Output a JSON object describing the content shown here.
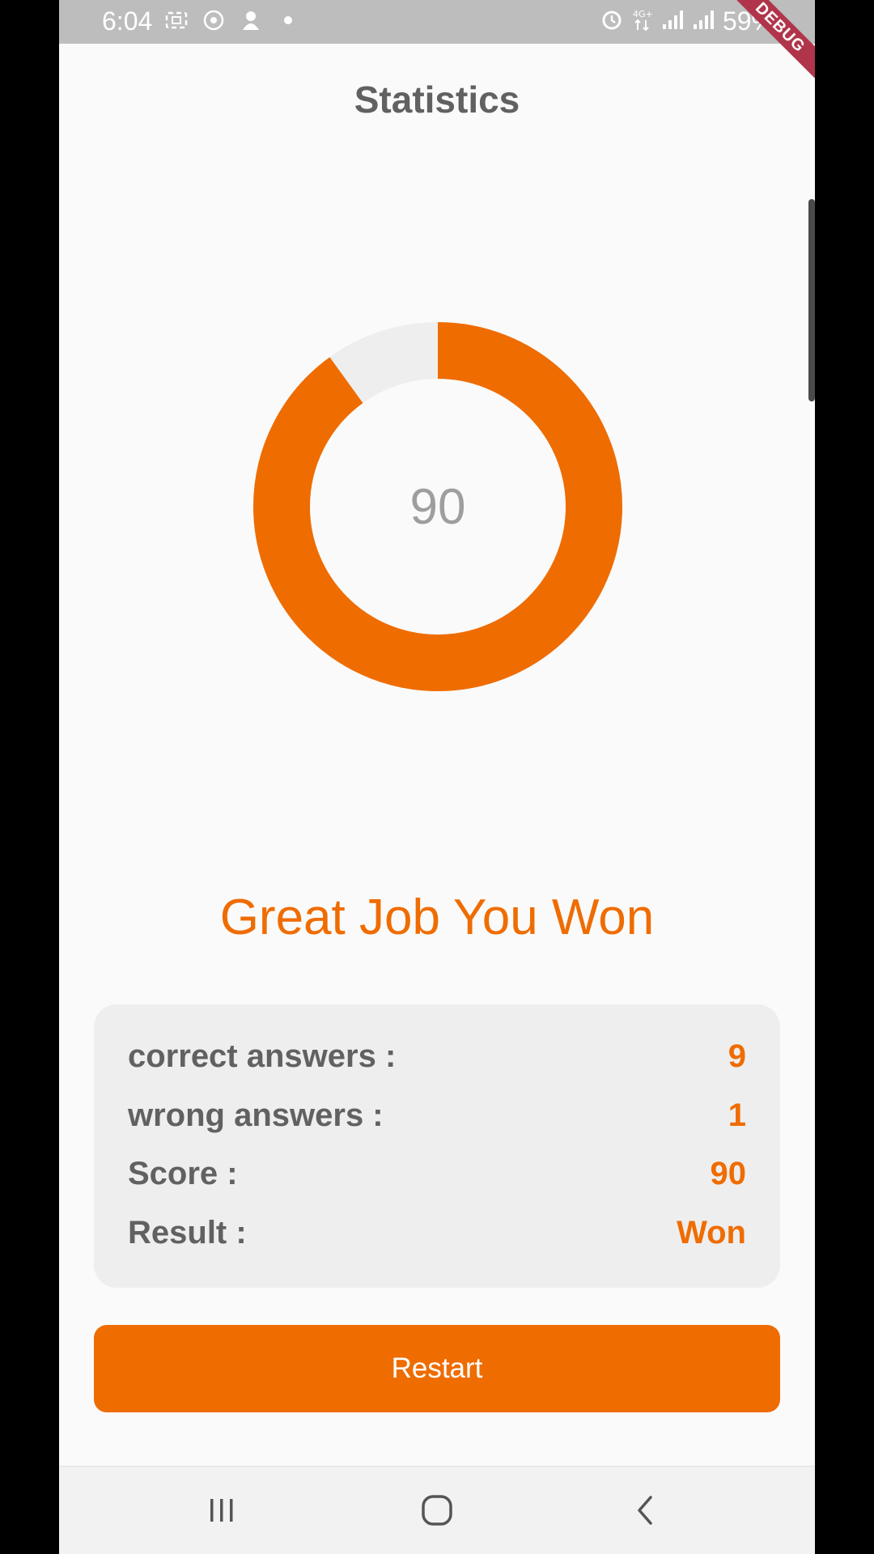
{
  "status_bar": {
    "time": "6:04",
    "battery": "59%",
    "left_icons": [
      "screen-record-icon",
      "wifi-hotspot-icon",
      "app-notification-icon",
      "dot-icon"
    ],
    "right_icons": [
      "alarm-icon",
      "4g-icon",
      "signal-icon",
      "signal-icon"
    ]
  },
  "debug_banner": "DEBUG",
  "app_bar": {
    "title": "Statistics"
  },
  "donut": {
    "score_label": "90",
    "progress_fraction": 0.9,
    "fill_color": "#ef6c00",
    "track_color": "#eeeeee"
  },
  "headline": "Great Job You Won",
  "stats": [
    {
      "label": "correct answers :",
      "value": "9"
    },
    {
      "label": "wrong answers :",
      "value": "1"
    },
    {
      "label": "Score :",
      "value": "90"
    },
    {
      "label": "Result :",
      "value": "Won"
    }
  ],
  "restart_button": {
    "label": "Restart"
  },
  "nav_bar": {
    "items": [
      "recent-apps-icon",
      "home-icon",
      "back-icon"
    ]
  },
  "colors": {
    "accent": "#ef6c00",
    "title_gray": "#616161",
    "card_bg": "#eeeeee"
  }
}
